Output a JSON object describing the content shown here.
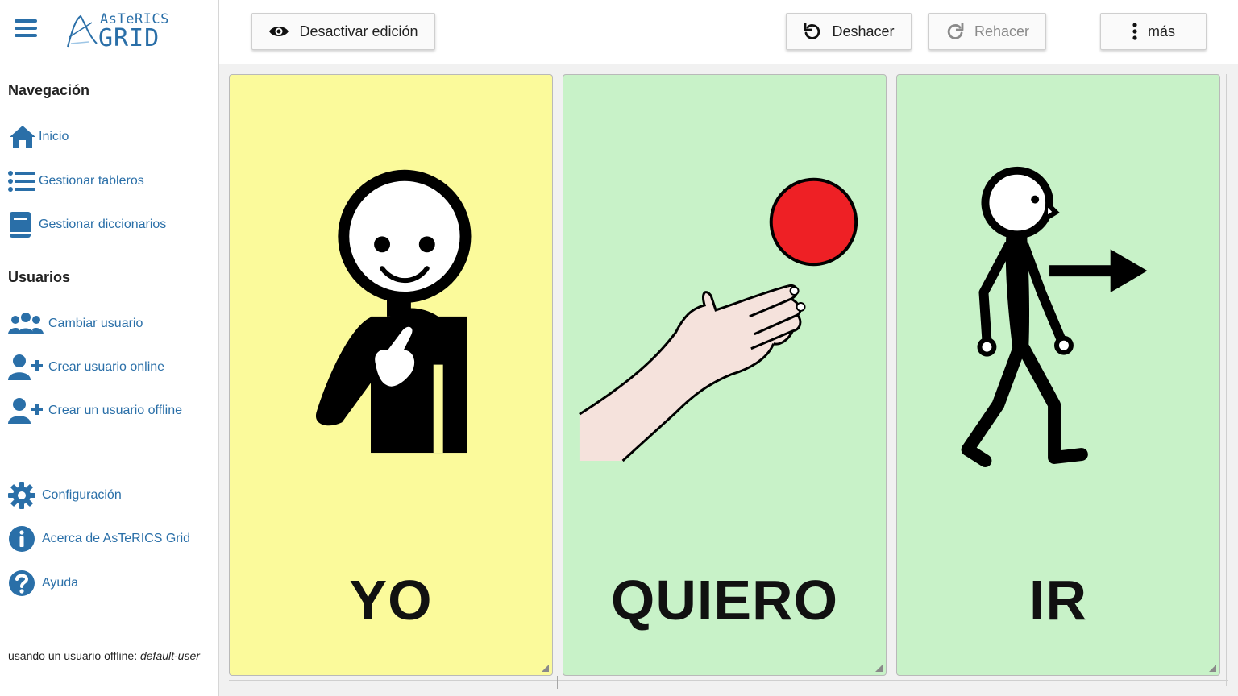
{
  "app": {
    "logo_top": "AsTeRICS",
    "logo_bottom": "GRID"
  },
  "sidebar": {
    "nav_title": "Navegación",
    "nav_items": [
      {
        "label": "Inicio",
        "icon": "home-icon"
      },
      {
        "label": "Gestionar tableros",
        "icon": "list-icon"
      },
      {
        "label": "Gestionar diccionarios",
        "icon": "book-icon"
      }
    ],
    "users_title": "Usuarios",
    "user_items": [
      {
        "label": "Cambiar usuario",
        "icon": "users-icon"
      },
      {
        "label": "Crear usuario online",
        "icon": "user-plus-icon"
      },
      {
        "label": "Crear un usuario offline",
        "icon": "user-plus-icon"
      }
    ],
    "other_items": [
      {
        "label": "Configuración",
        "icon": "gear-icon"
      },
      {
        "label": "Acerca de AsTeRICS Grid",
        "icon": "info-icon"
      },
      {
        "label": "Ayuda",
        "icon": "help-icon"
      }
    ],
    "footer_prefix": "usando un usuario offline: ",
    "footer_user": "default-user"
  },
  "toolbar": {
    "edit_toggle": "Desactivar edición",
    "undo": "Deshacer",
    "redo": "Rehacer",
    "more": "más"
  },
  "grid": {
    "cells": [
      {
        "word": "YO",
        "bg": "#fbfa9b",
        "picto": "person-pointing-self"
      },
      {
        "word": "QUIERO",
        "bg": "#c8f2c8",
        "picto": "hand-reaching-ball"
      },
      {
        "word": "IR",
        "bg": "#c8f2c8",
        "picto": "person-walking-arrow"
      }
    ]
  },
  "colors": {
    "accent": "#2a6fa8",
    "yellow_cell": "#fbfa9b",
    "green_cell": "#c8f2c8",
    "ball": "#ee2025"
  }
}
